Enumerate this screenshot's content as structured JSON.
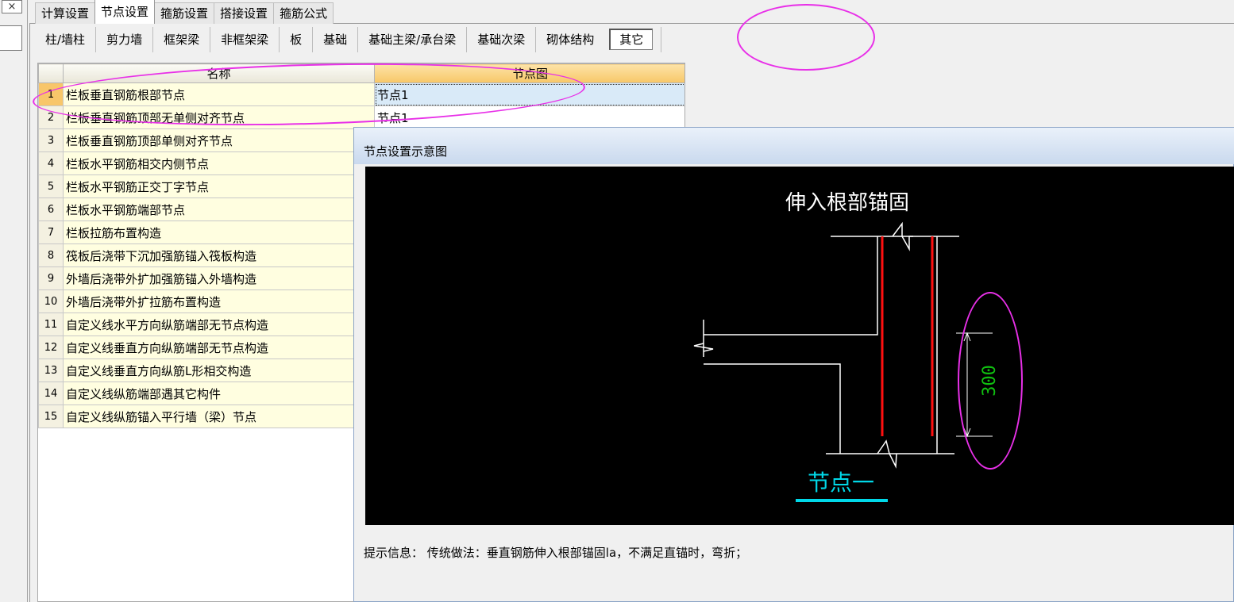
{
  "window": {
    "close_label": "×"
  },
  "top_tabs": [
    "计算设置",
    "节点设置",
    "箍筋设置",
    "搭接设置",
    "箍筋公式"
  ],
  "top_tabs_active": 1,
  "sub_tabs": [
    "柱/墙柱",
    "剪力墙",
    "框架梁",
    "非框架梁",
    "板",
    "基础",
    "基础主梁/承台梁",
    "基础次梁",
    "砌体结构",
    "其它"
  ],
  "sub_tabs_active": 9,
  "grid": {
    "headers": [
      "名称",
      "节点图"
    ],
    "rows": [
      {
        "no": "1",
        "name": "栏板垂直钢筋根部节点",
        "node": "节点1"
      },
      {
        "no": "2",
        "name": "栏板垂直钢筋顶部无单侧对齐节点",
        "node": "节点1"
      },
      {
        "no": "3",
        "name": "栏板垂直钢筋顶部单侧对齐节点",
        "node": ""
      },
      {
        "no": "4",
        "name": "栏板水平钢筋相交内侧节点",
        "node": ""
      },
      {
        "no": "5",
        "name": "栏板水平钢筋正交丁字节点",
        "node": ""
      },
      {
        "no": "6",
        "name": "栏板水平钢筋端部节点",
        "node": ""
      },
      {
        "no": "7",
        "name": "栏板拉筋布置构造",
        "node": ""
      },
      {
        "no": "8",
        "name": "筏板后浇带下沉加强筋锚入筏板构造",
        "node": ""
      },
      {
        "no": "9",
        "name": "外墙后浇带外扩加强筋锚入外墙构造",
        "node": ""
      },
      {
        "no": "10",
        "name": "外墙后浇带外扩拉筋布置构造",
        "node": ""
      },
      {
        "no": "11",
        "name": "自定义线水平方向纵筋端部无节点构造",
        "node": ""
      },
      {
        "no": "12",
        "name": "自定义线垂直方向纵筋端部无节点构造",
        "node": ""
      },
      {
        "no": "13",
        "name": "自定义线垂直方向纵筋L形相交构造",
        "node": ""
      },
      {
        "no": "14",
        "name": "自定义线纵筋端部遇其它构件",
        "node": ""
      },
      {
        "no": "15",
        "name": "自定义线纵筋锚入平行墙（梁）节点",
        "node": ""
      }
    ],
    "selected_row": 0
  },
  "diagram": {
    "title": "节点设置示意图",
    "heading": "伸入根部锚固",
    "dimension": "300",
    "caption": "节点一",
    "hint": "提示信息： 传统做法：垂直钢筋伸入根部锚固la，不满足直锚时，弯折；"
  },
  "colors": {
    "rebar": "#ff1010",
    "dimension": "#10c010",
    "caption": "#00d8e8",
    "annotation": "#e830e8",
    "header_highlight": "#f7c768",
    "selected_cell": "#d9eaf8"
  }
}
